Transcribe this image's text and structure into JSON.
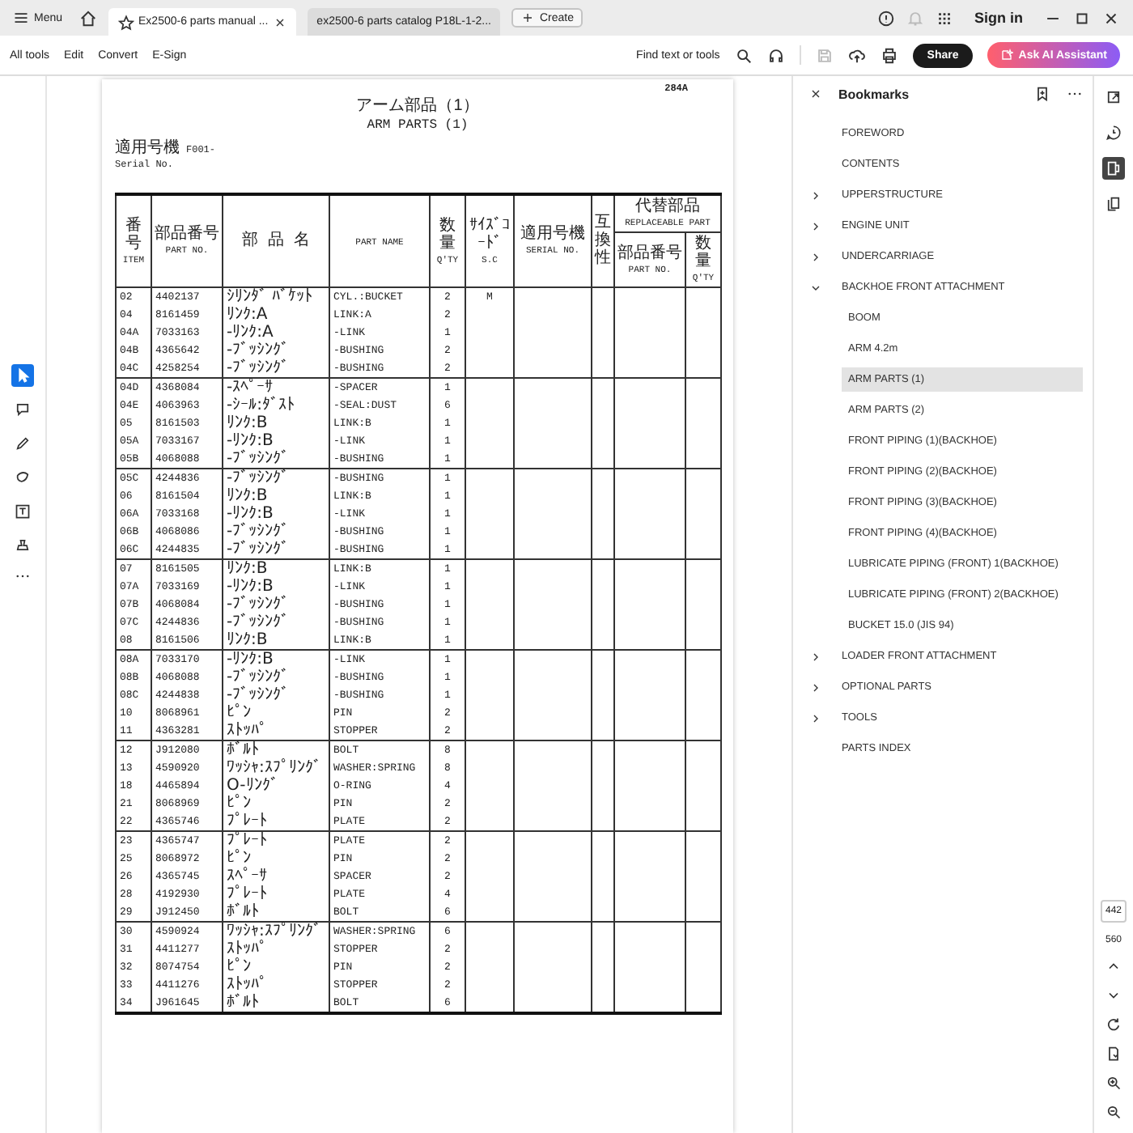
{
  "tab_bar": {
    "menu": "Menu",
    "tabs": [
      {
        "label": "Ex2500-6 parts manual ...",
        "selected": true
      },
      {
        "label": "ex2500-6 parts catalog P18L-1-2...",
        "selected": false
      }
    ],
    "create": "Create",
    "sign_in": "Sign in"
  },
  "toolbar": {
    "items": [
      "All tools",
      "Edit",
      "Convert",
      "E-Sign"
    ],
    "search": "Find text or tools",
    "share": "Share",
    "ai_assistant": "Ask AI Assistant"
  },
  "left_tools": [
    {
      "kind": "select",
      "selected": true
    },
    {
      "kind": "comment",
      "selected": false
    },
    {
      "kind": "draw",
      "selected": false
    },
    {
      "kind": "shape",
      "selected": false
    },
    {
      "kind": "text",
      "selected": false
    },
    {
      "kind": "stamp",
      "selected": false
    }
  ],
  "document": {
    "page_code": "284A",
    "title_jp": "アーム部品（1）",
    "title": "ARM PARTS (1)",
    "serial_label_jp": "適用号機",
    "serial_value": "F001-",
    "serial_label": "Serial No.",
    "columns": [
      {
        "kind": "text",
        "jp": "番号",
        "en": "ITEM"
      },
      {
        "kind": "text",
        "jp": "部品番号",
        "en": "PART NO."
      },
      {
        "kind": "text",
        "jp": "部 品 名"
      },
      {
        "kind": "text",
        "en": "PART NAME"
      },
      {
        "kind": "text",
        "jp": "数量",
        "en": "Q'TY"
      },
      {
        "kind": "text",
        "jp": "ｻｲｽﾞｺｰﾄﾞ",
        "en": "S.C"
      },
      {
        "kind": "text",
        "jp": "適用号機",
        "en": "SERIAL NO."
      },
      {
        "kind": "vertical",
        "jp": "互換性"
      }
    ],
    "replaceable": {
      "jp": "代替部品",
      "en": "REPLACEABLE PART",
      "columns": [
        {
          "jp": "部品番号",
          "en": "PART NO."
        },
        {
          "jp": "数量",
          "en": "Q'TY"
        }
      ]
    },
    "rows": [
      {
        "item": "02",
        "part_no": "4402137",
        "name_jp": "ｼﾘﾝﾀﾞ ﾊﾞｹｯﾄ",
        "name": "CYL.:BUCKET",
        "qty": "2",
        "sc": "M"
      },
      {
        "item": "04",
        "part_no": "8161459",
        "name_jp": "ﾘﾝｸ:A",
        "name": "LINK:A",
        "qty": "2"
      },
      {
        "item": "04A",
        "part_no": "7033163",
        "name_jp": "-ﾘﾝｸ:A",
        "name": "-LINK",
        "qty": "1"
      },
      {
        "item": "04B",
        "part_no": "4365642",
        "name_jp": "-ﾌﾞｯｼﾝｸﾞ",
        "name": "-BUSHING",
        "qty": "2"
      },
      {
        "item": "04C",
        "part_no": "4258254",
        "name_jp": "-ﾌﾞｯｼﾝｸﾞ",
        "name": "-BUSHING",
        "qty": "2"
      },
      {
        "item": "04D",
        "part_no": "4368084",
        "name_jp": "-ｽﾍﾟｰｻ",
        "name": "-SPACER",
        "qty": "1"
      },
      {
        "item": "04E",
        "part_no": "4063963",
        "name_jp": "-ｼｰﾙ:ﾀﾞｽﾄ",
        "name": "-SEAL:DUST",
        "qty": "6"
      },
      {
        "item": "05",
        "part_no": "8161503",
        "name_jp": "ﾘﾝｸ:B",
        "name": "LINK:B",
        "qty": "1"
      },
      {
        "item": "05A",
        "part_no": "7033167",
        "name_jp": "-ﾘﾝｸ:B",
        "name": "-LINK",
        "qty": "1"
      },
      {
        "item": "05B",
        "part_no": "4068088",
        "name_jp": "-ﾌﾞｯｼﾝｸﾞ",
        "name": "-BUSHING",
        "qty": "1"
      },
      {
        "item": "05C",
        "part_no": "4244836",
        "name_jp": "-ﾌﾞｯｼﾝｸﾞ",
        "name": "-BUSHING",
        "qty": "1"
      },
      {
        "item": "06",
        "part_no": "8161504",
        "name_jp": "ﾘﾝｸ:B",
        "name": "LINK:B",
        "qty": "1"
      },
      {
        "item": "06A",
        "part_no": "7033168",
        "name_jp": "-ﾘﾝｸ:B",
        "name": "-LINK",
        "qty": "1"
      },
      {
        "item": "06B",
        "part_no": "4068086",
        "name_jp": "-ﾌﾞｯｼﾝｸﾞ",
        "name": "-BUSHING",
        "qty": "1"
      },
      {
        "item": "06C",
        "part_no": "4244835",
        "name_jp": "-ﾌﾞｯｼﾝｸﾞ",
        "name": "-BUSHING",
        "qty": "1"
      },
      {
        "item": "07",
        "part_no": "8161505",
        "name_jp": "ﾘﾝｸ:B",
        "name": "LINK:B",
        "qty": "1"
      },
      {
        "item": "07A",
        "part_no": "7033169",
        "name_jp": "-ﾘﾝｸ:B",
        "name": "-LINK",
        "qty": "1"
      },
      {
        "item": "07B",
        "part_no": "4068084",
        "name_jp": "-ﾌﾞｯｼﾝｸﾞ",
        "name": "-BUSHING",
        "qty": "1"
      },
      {
        "item": "07C",
        "part_no": "4244836",
        "name_jp": "-ﾌﾞｯｼﾝｸﾞ",
        "name": "-BUSHING",
        "qty": "1"
      },
      {
        "item": "08",
        "part_no": "8161506",
        "name_jp": "ﾘﾝｸ:B",
        "name": "LINK:B",
        "qty": "1"
      },
      {
        "item": "08A",
        "part_no": "7033170",
        "name_jp": "-ﾘﾝｸ:B",
        "name": "-LINK",
        "qty": "1"
      },
      {
        "item": "08B",
        "part_no": "4068088",
        "name_jp": "-ﾌﾞｯｼﾝｸﾞ",
        "name": "-BUSHING",
        "qty": "1"
      },
      {
        "item": "08C",
        "part_no": "4244838",
        "name_jp": "-ﾌﾞｯｼﾝｸﾞ",
        "name": "-BUSHING",
        "qty": "1"
      },
      {
        "item": "10",
        "part_no": "8068961",
        "name_jp": "ﾋﾟﾝ",
        "name": "PIN",
        "qty": "2"
      },
      {
        "item": "11",
        "part_no": "4363281",
        "name_jp": "ｽﾄｯﾊﾟ",
        "name": "STOPPER",
        "qty": "2"
      },
      {
        "item": "12",
        "part_no": "J912080",
        "name_jp": "ﾎﾞﾙﾄ",
        "name": "BOLT",
        "qty": "8"
      },
      {
        "item": "13",
        "part_no": "4590920",
        "name_jp": "ﾜｯｼｬ:ｽﾌﾟﾘﾝｸﾞ",
        "name": "WASHER:SPRING",
        "qty": "8"
      },
      {
        "item": "18",
        "part_no": "4465894",
        "name_jp": "O-ﾘﾝｸﾞ",
        "name": "O-RING",
        "qty": "4"
      },
      {
        "item": "21",
        "part_no": "8068969",
        "name_jp": "ﾋﾟﾝ",
        "name": "PIN",
        "qty": "2"
      },
      {
        "item": "22",
        "part_no": "4365746",
        "name_jp": "ﾌﾟﾚｰﾄ",
        "name": "PLATE",
        "qty": "2"
      },
      {
        "item": "23",
        "part_no": "4365747",
        "name_jp": "ﾌﾟﾚｰﾄ",
        "name": "PLATE",
        "qty": "2"
      },
      {
        "item": "25",
        "part_no": "8068972",
        "name_jp": "ﾋﾟﾝ",
        "name": "PIN",
        "qty": "2"
      },
      {
        "item": "26",
        "part_no": "4365745",
        "name_jp": "ｽﾍﾟｰｻ",
        "name": "SPACER",
        "qty": "2"
      },
      {
        "item": "28",
        "part_no": "4192930",
        "name_jp": "ﾌﾟﾚｰﾄ",
        "name": "PLATE",
        "qty": "4"
      },
      {
        "item": "29",
        "part_no": "J912450",
        "name_jp": "ﾎﾞﾙﾄ",
        "name": "BOLT",
        "qty": "6"
      },
      {
        "item": "30",
        "part_no": "4590924",
        "name_jp": "ﾜｯｼｬ:ｽﾌﾟﾘﾝｸﾞ",
        "name": "WASHER:SPRING",
        "qty": "6"
      },
      {
        "item": "31",
        "part_no": "4411277",
        "name_jp": "ｽﾄｯﾊﾟ",
        "name": "STOPPER",
        "qty": "2"
      },
      {
        "item": "32",
        "part_no": "8074754",
        "name_jp": "ﾋﾟﾝ",
        "name": "PIN",
        "qty": "2"
      },
      {
        "item": "33",
        "part_no": "4411276",
        "name_jp": "ｽﾄｯﾊﾟ",
        "name": "STOPPER",
        "qty": "2"
      },
      {
        "item": "34",
        "part_no": "J961645",
        "name_jp": "ﾎﾞﾙﾄ",
        "name": "BOLT",
        "qty": "6"
      }
    ]
  },
  "bookmarks": {
    "title": "Bookmarks",
    "items": [
      {
        "label": "FOREWORD",
        "selected": false
      },
      {
        "label": "CONTENTS",
        "selected": false
      },
      {
        "label": "UPPERSTRUCTURE",
        "selected": false,
        "expanded": false
      },
      {
        "label": "ENGINE UNIT",
        "selected": false,
        "expanded": false
      },
      {
        "label": "UNDERCARRIAGE",
        "selected": false,
        "expanded": false
      },
      {
        "label": "BACKHOE FRONT ATTACHMENT",
        "selected": false,
        "expanded": true,
        "children": [
          {
            "label": "BOOM",
            "selected": false
          },
          {
            "label": "ARM 4.2m",
            "selected": false
          },
          {
            "label": "ARM PARTS (1)",
            "selected": true
          },
          {
            "label": "ARM PARTS (2)",
            "selected": false
          },
          {
            "label": "FRONT PIPING (1)(BACKHOE)",
            "selected": false
          },
          {
            "label": "FRONT PIPING (2)(BACKHOE)",
            "selected": false
          },
          {
            "label": "FRONT PIPING (3)(BACKHOE)",
            "selected": false
          },
          {
            "label": "FRONT PIPING (4)(BACKHOE)",
            "selected": false
          },
          {
            "label": "LUBRICATE PIPING (FRONT) 1(BACKHOE)",
            "selected": false
          },
          {
            "label": "LUBRICATE PIPING (FRONT) 2(BACKHOE)",
            "selected": false
          },
          {
            "label": "BUCKET 15.0 (JIS 94)",
            "selected": false
          }
        ]
      },
      {
        "label": "LOADER FRONT ATTACHMENT",
        "selected": false,
        "expanded": false
      },
      {
        "label": "OPTIONAL PARTS",
        "selected": false,
        "expanded": false
      },
      {
        "label": "TOOLS",
        "selected": false,
        "expanded": false
      },
      {
        "label": "PARTS INDEX",
        "selected": false
      }
    ]
  },
  "right_tools": [
    {
      "kind": "export",
      "selected": false
    },
    {
      "kind": "chat",
      "selected": false
    },
    {
      "kind": "panel",
      "selected": true
    },
    {
      "kind": "pages",
      "selected": false
    }
  ],
  "page_nav": {
    "current": "442",
    "total": "560"
  }
}
